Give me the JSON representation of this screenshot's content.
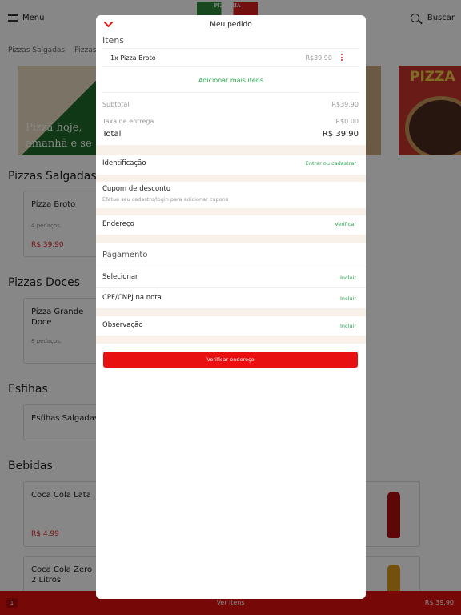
{
  "header": {
    "menu_label": "Menu",
    "logo_text": "PIZZARIA",
    "search_label": "Buscar"
  },
  "category_tabs": [
    "Pizzas Salgadas",
    "Pizzas"
  ],
  "banners": {
    "left_text_line1": "Pizza hoje,",
    "left_text_line2": "amanhã e se",
    "right_text": "PIZZA NU"
  },
  "sections": [
    {
      "title": "Pizzas Salgadas",
      "item": {
        "name": "Pizza Broto",
        "desc": "4 pedaços.",
        "price": "R$ 39.90"
      }
    },
    {
      "title": "Pizzas Doces",
      "item": {
        "name": "Pizza Grande Doce",
        "desc": "8 pedaços.",
        "price": ""
      }
    },
    {
      "title": "Esfihas",
      "item": {
        "name": "Esfihas Salgadas",
        "desc": "",
        "price": ""
      }
    },
    {
      "title": "Bebidas",
      "items": [
        {
          "name": "Coca Cola Lata",
          "price": "R$ 4.99"
        },
        {
          "name": "Coca Cola Zero 2 Litros",
          "price": ""
        }
      ]
    }
  ],
  "cart_bar": {
    "count": "1",
    "label": "Ver itens",
    "total": "R$ 39.90"
  },
  "modal": {
    "title": "Meu pedido",
    "items_heading": "Itens",
    "items": [
      {
        "name": "1x Pizza Broto",
        "price": "R$39.90"
      }
    ],
    "add_more": "Adicionar mais itens",
    "subtotal_label": "Subtotal",
    "subtotal_value": "R$39.90",
    "delivery_label": "Taxa de entrega",
    "delivery_value": "R$0.00",
    "total_label": "Total",
    "total_value": "R$ 39.90",
    "identification_label": "Identificação",
    "identification_link": "Entrar ou cadastrar",
    "coupon_label": "Cupom de desconto",
    "coupon_sub": "Efetue seu cadastro/login para adicionar cupons",
    "address_label": "Endereço",
    "address_link": "Verificar",
    "payment_heading": "Pagamento",
    "select_label": "Selecionar",
    "select_link": "Incluir",
    "cpf_label": "CPF/CNPJ na nota",
    "cpf_link": "Incluir",
    "note_label": "Observação",
    "note_link": "Incluir",
    "cta_label": "Verificar endereço"
  },
  "colors": {
    "accent_red": "#e81010",
    "link_green": "#2aa44f",
    "section_gap": "#f7f1ea"
  }
}
